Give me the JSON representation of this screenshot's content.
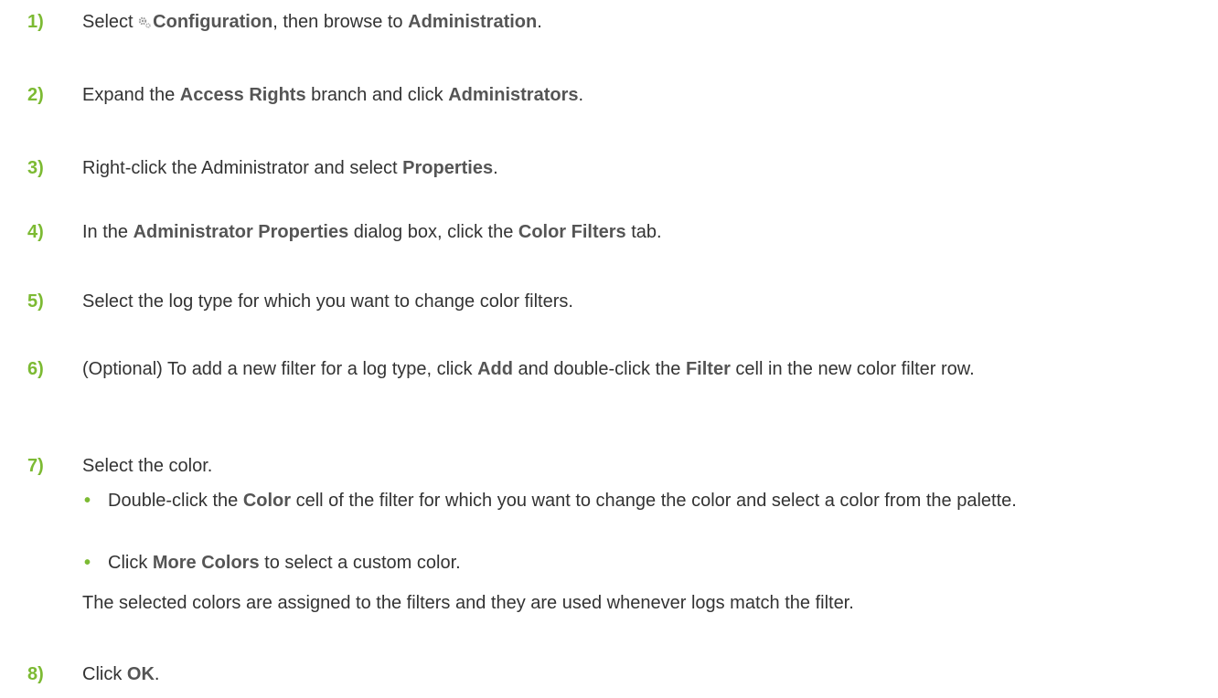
{
  "steps": [
    {
      "num": "1)",
      "parts": [
        "Select ",
        "Configuration",
        ", then browse to ",
        "Administration",
        "."
      ]
    },
    {
      "num": "2)",
      "parts": [
        "Expand the ",
        "Access Rights",
        " branch and click ",
        "Administrators",
        "."
      ]
    },
    {
      "num": "3)",
      "parts": [
        "Right-click the Administrator and select ",
        "Properties",
        "."
      ]
    },
    {
      "num": "4)",
      "parts": [
        "In the ",
        "Administrator Properties",
        " dialog box, click the ",
        "Color Filters",
        " tab."
      ]
    },
    {
      "num": "5)",
      "parts": [
        "Select the log type for which you want to change color filters."
      ]
    },
    {
      "num": "6)",
      "parts": [
        "(Optional) To add a new filter for a log type, click ",
        "Add",
        " and double-click the ",
        "Filter",
        " cell in the new color filter row."
      ]
    },
    {
      "num": "7)",
      "parts": [
        "Select the color."
      ]
    },
    {
      "num": "8)",
      "parts": [
        "Click ",
        "OK",
        "."
      ]
    }
  ],
  "step7_bullets": [
    {
      "parts": [
        "Double-click the ",
        "Color",
        " cell of the filter for which you want to change the color and select a color from the palette."
      ]
    },
    {
      "parts": [
        "Click ",
        "More Colors",
        " to select a custom color."
      ]
    }
  ],
  "step7_note": "The selected colors are assigned to the filters and they are used whenever logs match the filter.",
  "bullet_char": "•",
  "colors": {
    "accent": "#7cba33",
    "ui_text": "#555555",
    "body_text": "#333333"
  },
  "icons": {
    "configuration": "gear-icon"
  }
}
